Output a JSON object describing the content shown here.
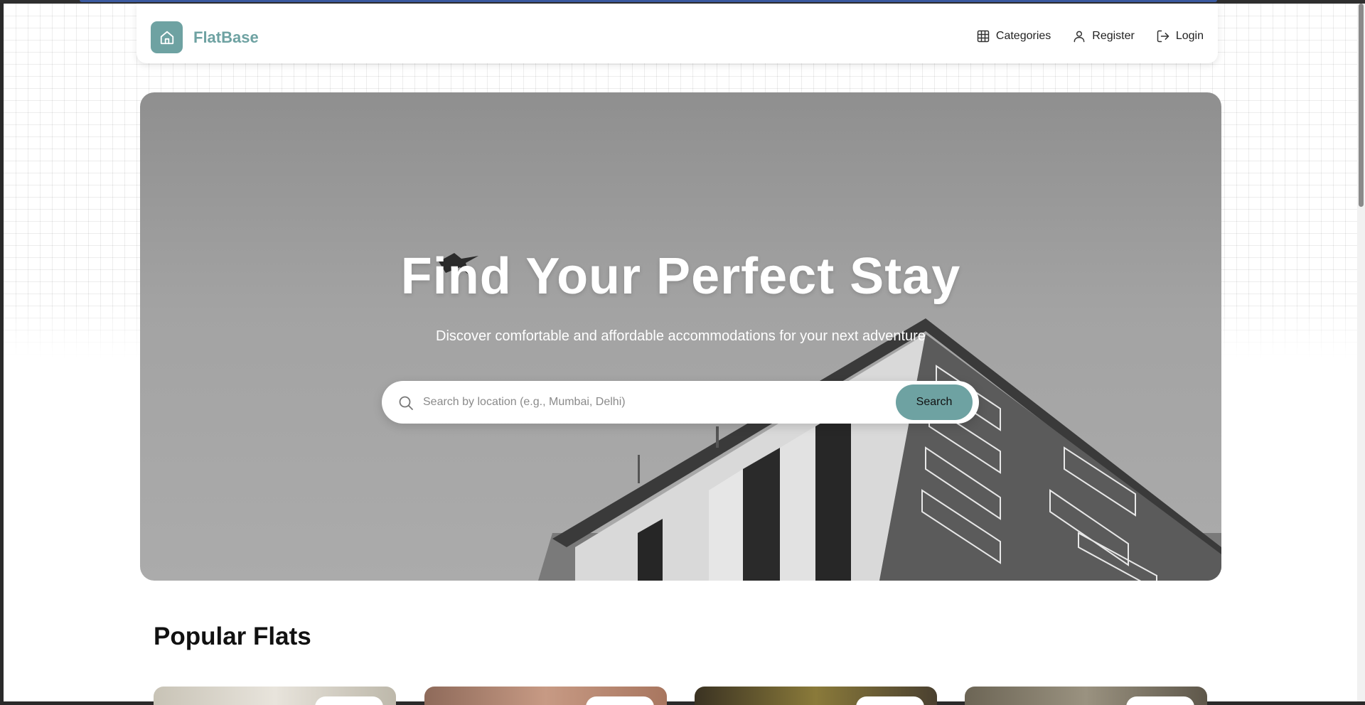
{
  "brand": {
    "name": "FlatBase",
    "logo_icon": "home-icon",
    "color": "#6ea2a2"
  },
  "nav": {
    "links": [
      {
        "label": "Categories",
        "icon": "grid-icon"
      },
      {
        "label": "Register",
        "icon": "user-icon"
      },
      {
        "label": "Login",
        "icon": "login-icon"
      }
    ]
  },
  "hero": {
    "title": "Find Your Perfect Stay",
    "subtitle": "Discover comfortable and affordable accommodations for your next adventure",
    "search": {
      "placeholder": "Search by location (e.g., Mumbai, Delhi)",
      "value": "",
      "button_label": "Search",
      "icon": "search-icon"
    }
  },
  "popular": {
    "title": "Popular Flats",
    "card_count_visible": 4
  },
  "colors": {
    "accent": "#6ea2a2",
    "text": "#111111"
  }
}
